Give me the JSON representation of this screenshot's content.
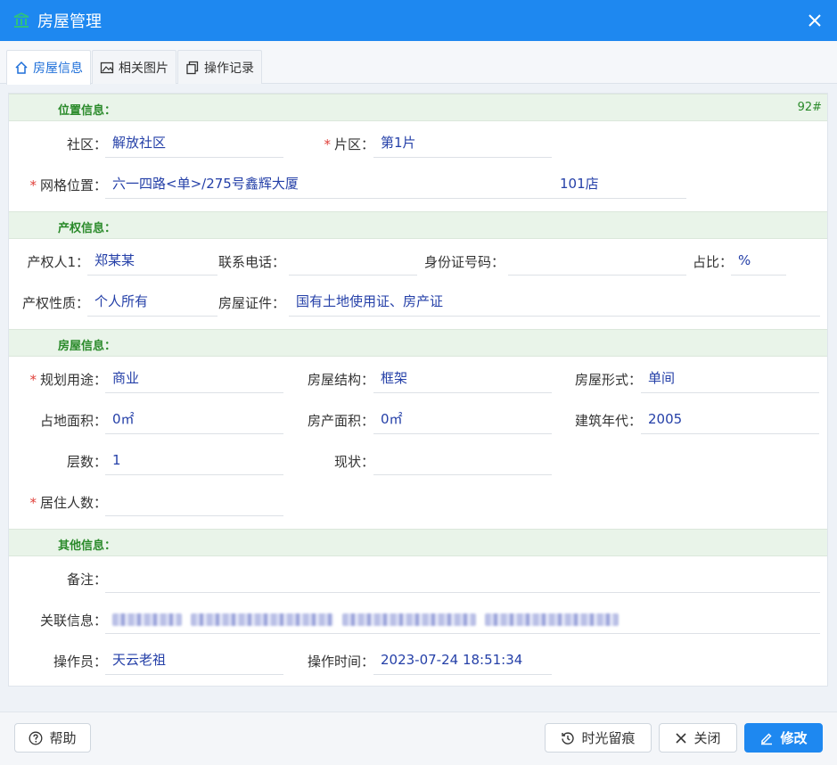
{
  "window": {
    "title": "房屋管理",
    "close_label": "✕"
  },
  "tabs": [
    {
      "label": "房屋信息"
    },
    {
      "label": "相关图片"
    },
    {
      "label": "操作记录"
    }
  ],
  "location": {
    "header": "位置信息：",
    "badge": "92#",
    "community_label": "社区：",
    "community_value": "解放社区",
    "district_label": "片区：",
    "district_value": "第1片",
    "grid_label": "网格位置：",
    "grid_value": "六一四路<单>/275号鑫辉大厦",
    "grid_value2": "101店"
  },
  "property": {
    "header": "产权信息：",
    "owner_label": "产权人1：",
    "owner_value": "郑某某",
    "phone_label": "联系电话：",
    "phone_value": "",
    "id_label": "身份证号码：",
    "id_value": "",
    "ratio_label": "占比：",
    "ratio_value": "%",
    "nature_label": "产权性质：",
    "nature_value": "个人所有",
    "cert_label": "房屋证件：",
    "cert_value": "国有土地使用证、房产证"
  },
  "house": {
    "header": "房屋信息：",
    "usage_label": "规划用途：",
    "usage_value": "商业",
    "structure_label": "房屋结构：",
    "structure_value": "框架",
    "form_label": "房屋形式：",
    "form_value": "单间",
    "land_area_label": "占地面积：",
    "land_area_value": "0㎡",
    "prop_area_label": "房产面积：",
    "prop_area_value": "0㎡",
    "year_label": "建筑年代：",
    "year_value": "2005",
    "floors_label": "层数：",
    "floors_value": "1",
    "status_label": "现状：",
    "status_value": "",
    "residents_label": "居住人数：",
    "residents_value": ""
  },
  "other": {
    "header": "其他信息：",
    "remark_label": "备注：",
    "remark_value": "",
    "related_label": "关联信息：",
    "operator_label": "操作员：",
    "operator_value": "天云老祖",
    "optime_label": "操作时间：",
    "optime_value": "2023-07-24 18:51:34"
  },
  "footer": {
    "help": "帮助",
    "history": "时光留痕",
    "close": "关闭",
    "edit": "修改"
  },
  "colors": {
    "primary": "#1e88f0",
    "section_bg": "#e9f4e9",
    "section_text": "#2a8a2a",
    "value_text": "#2540a8",
    "required": "#e0403a"
  }
}
